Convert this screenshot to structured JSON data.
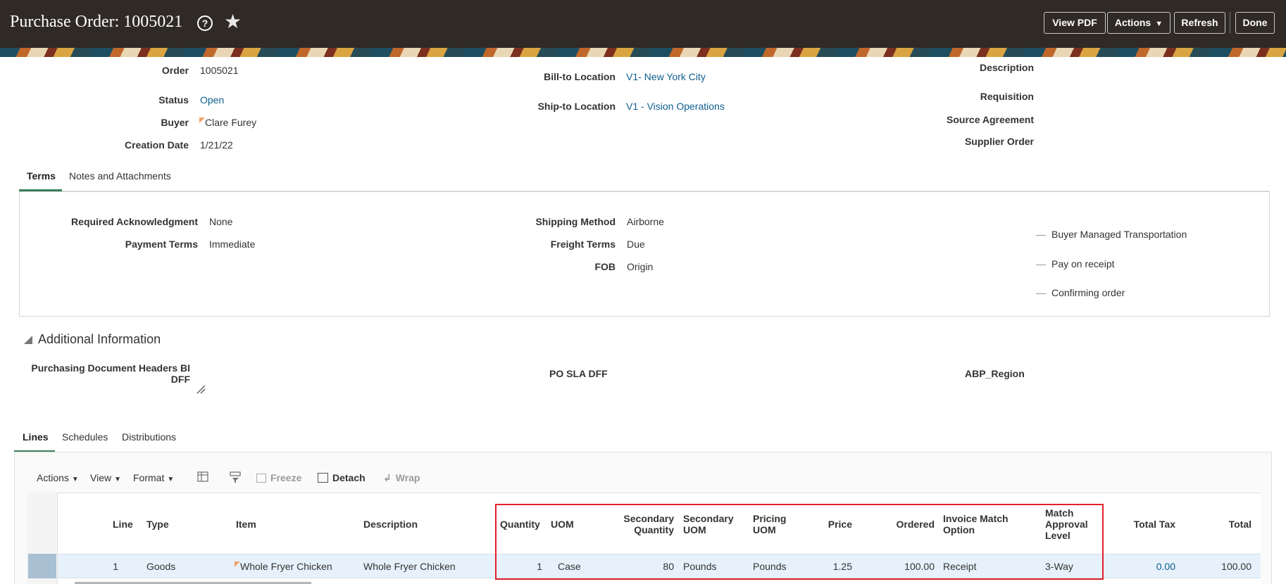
{
  "header": {
    "title": "Purchase Order: 1005021",
    "help_icon": "?",
    "star_icon": "★",
    "buttons": {
      "view_pdf": "View PDF",
      "actions": "Actions",
      "refresh": "Refresh",
      "done": "Done"
    }
  },
  "summary": {
    "order_label": "Order",
    "order_value": "1005021",
    "status_label": "Status",
    "status_value": "Open",
    "buyer_label": "Buyer",
    "buyer_value": "Clare Furey",
    "creation_date_label": "Creation Date",
    "creation_date_value": "1/21/22",
    "bill_to_label": "Bill-to Location",
    "bill_to_value": "V1- New York City",
    "ship_to_label": "Ship-to Location",
    "ship_to_value": "V1 - Vision Operations",
    "description_label": "Description",
    "requisition_label": "Requisition",
    "source_agreement_label": "Source Agreement",
    "supplier_order_label": "Supplier Order"
  },
  "terms_tabs": [
    "Terms",
    "Notes and Attachments"
  ],
  "terms": {
    "required_ack_label": "Required Acknowledgment",
    "required_ack_value": "None",
    "payment_terms_label": "Payment Terms",
    "payment_terms_value": "Immediate",
    "shipping_method_label": "Shipping Method",
    "shipping_method_value": "Airborne",
    "freight_terms_label": "Freight Terms",
    "freight_terms_value": "Due",
    "fob_label": "FOB",
    "fob_value": "Origin",
    "flags": [
      "Buyer Managed Transportation",
      "Pay on receipt",
      "Confirming order"
    ]
  },
  "additional_info": {
    "title": "Additional Information",
    "dff1_line1": "Purchasing Document Headers BI",
    "dff1_line2": "DFF",
    "dff2": "PO SLA DFF",
    "dff3": "ABP_Region"
  },
  "lines_tabs": [
    "Lines",
    "Schedules",
    "Distributions"
  ],
  "toolbar": {
    "actions": "Actions",
    "view": "View",
    "format": "Format",
    "freeze": "Freeze",
    "detach": "Detach",
    "wrap": "Wrap"
  },
  "table": {
    "headers": {
      "line": "Line",
      "type": "Type",
      "item": "Item",
      "description": "Description",
      "quantity": "Quantity",
      "uom": "UOM",
      "secondary_quantity_1": "Secondary",
      "secondary_quantity_2": "Quantity",
      "secondary_uom_1": "Secondary",
      "secondary_uom_2": "UOM",
      "pricing_uom_1": "Pricing",
      "pricing_uom_2": "UOM",
      "price": "Price",
      "ordered": "Ordered",
      "invoice_match_1": "Invoice Match",
      "invoice_match_2": "Option",
      "match_approval_1": "Match",
      "match_approval_2": "Approval",
      "match_approval_3": "Level",
      "total_tax": "Total Tax",
      "total": "Total"
    },
    "rows": [
      {
        "line": "1",
        "type": "Goods",
        "item": "Whole Fryer Chicken",
        "description": "Whole Fryer Chicken",
        "quantity": "1",
        "uom": "Case",
        "secondary_quantity": "80",
        "secondary_uom": "Pounds",
        "pricing_uom": "Pounds",
        "price": "1.25",
        "ordered": "100.00",
        "invoice_match": "Receipt",
        "match_approval": "3-Way",
        "total_tax": "0.00",
        "total": "100.00"
      }
    ]
  },
  "colors": {
    "header_bg": "#2f2a26",
    "link": "#0e5f8f",
    "highlight": "#e0202a",
    "tab_accent": "#3b7f5a"
  }
}
